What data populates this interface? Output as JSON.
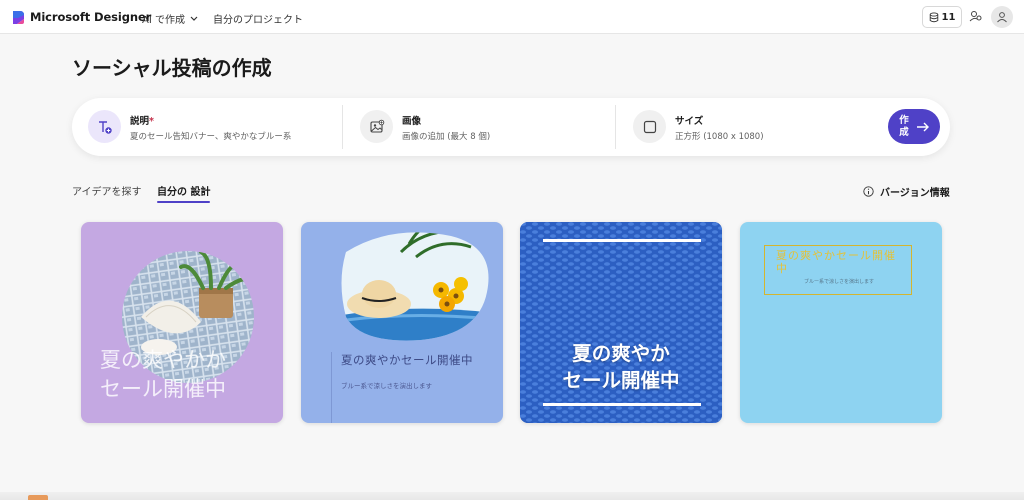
{
  "header": {
    "brand": "Microsoft Designer",
    "nav_create": "AI で作成",
    "nav_projects": "自分のプロジェクト",
    "credits": "11",
    "icons": {
      "logo": "designer-logo-icon",
      "credits": "coin-stack-icon",
      "share": "share-icon",
      "avatar": "user-avatar-icon"
    }
  },
  "page": {
    "title": "ソーシャル投稿の作成"
  },
  "prompt": {
    "description_label": "説明",
    "description_required": "*",
    "description_value": "夏のセール告知バナー、爽やかなブルー系",
    "image_label": "画像",
    "image_sub": "画像の追加 (最大 8 個)",
    "size_label": "サイズ",
    "size_sub": "正方形 (1080 x 1080)",
    "create_label": "作成"
  },
  "tabs": {
    "explore": "アイデアを探す",
    "my_designs": "自分の 設計",
    "version": "バージョン情報"
  },
  "cards": [
    {
      "headline_line1": "夏の爽やかか",
      "headline_line2": "セール開催中"
    },
    {
      "headline": "夏の爽やかセール開催中",
      "sub": "ブルー系で涼しさを演出します"
    },
    {
      "headline_line1": "夏の爽やか",
      "headline_line2": "セール開催中"
    },
    {
      "headline": "夏の爽やかセール開催中",
      "sub": "ブルー系で涼しさを演出します"
    }
  ],
  "colors": {
    "accent": "#4f41c7",
    "card1_bg": "#c4a8e2",
    "card2_bg": "#94b1ea",
    "card3_bg": "#2f64c8",
    "card4_bg": "#8ed3f1",
    "card4_text": "#e3c23a"
  }
}
